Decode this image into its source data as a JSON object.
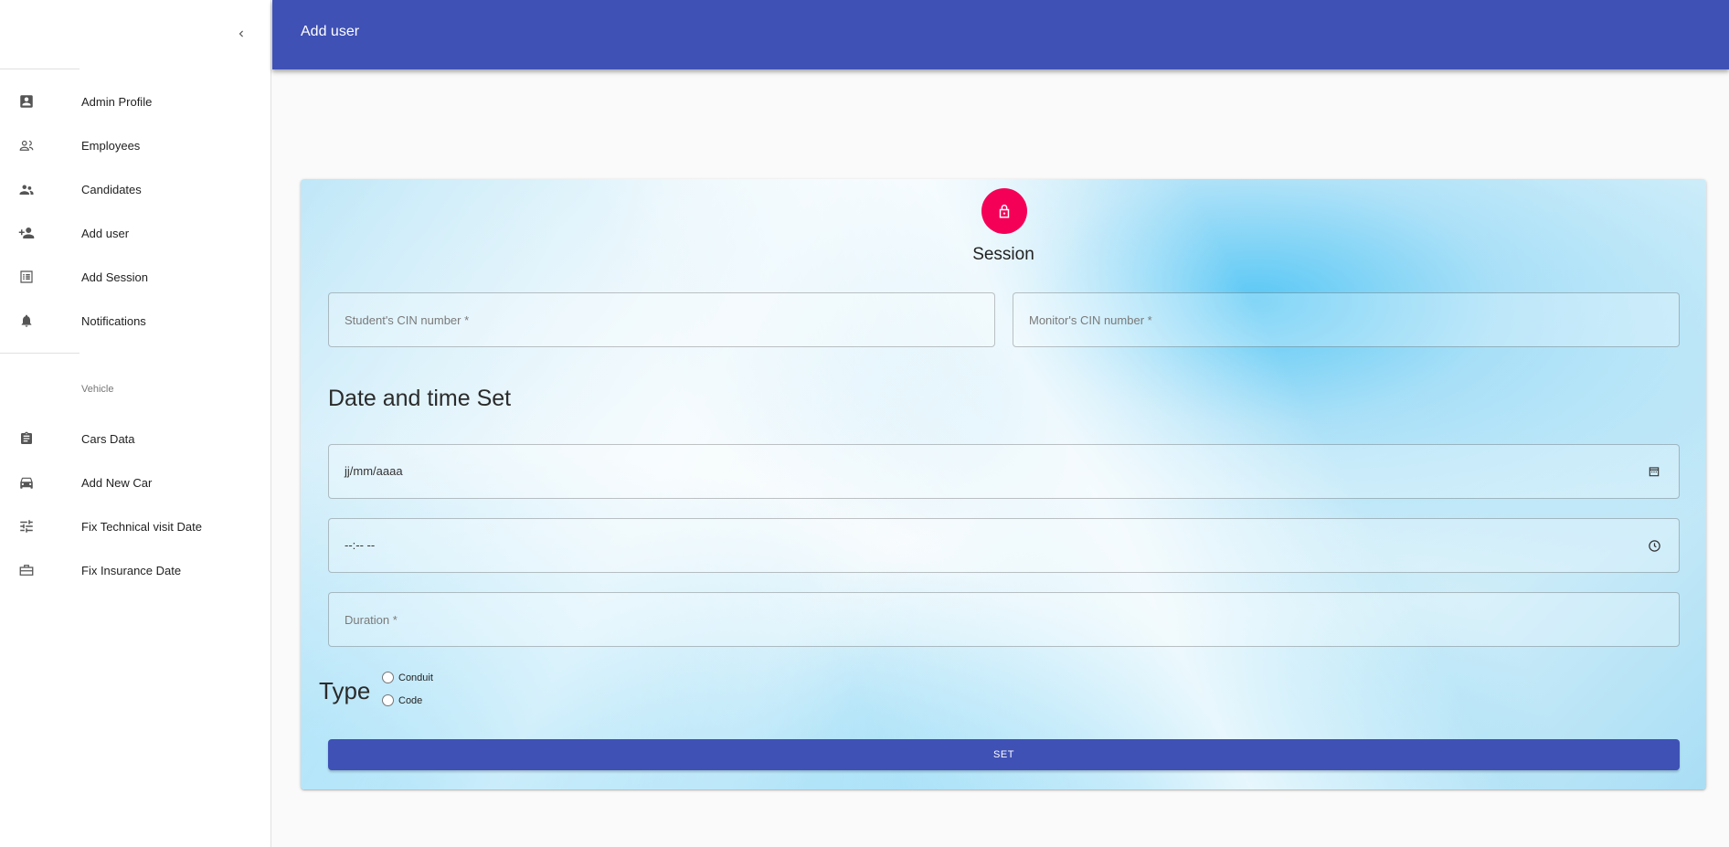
{
  "sidebar": {
    "collapse_icon": "chevron-left-icon",
    "items": [
      {
        "label": "Admin Profile",
        "icon": "account-box-icon"
      },
      {
        "label": "Employees",
        "icon": "people-outline-icon"
      },
      {
        "label": "Candidates",
        "icon": "supervisor-account-icon"
      },
      {
        "label": "Add user",
        "icon": "person-add-icon"
      },
      {
        "label": "Add Session",
        "icon": "list-alt-icon"
      },
      {
        "label": "Notifications",
        "icon": "notifications-icon"
      }
    ],
    "section_label": "Vehicle",
    "vehicle_items": [
      {
        "label": "Cars Data",
        "icon": "assignment-icon"
      },
      {
        "label": "Add New Car",
        "icon": "car-icon"
      },
      {
        "label": "Fix Technical visit Date",
        "icon": "tune-icon"
      },
      {
        "label": "Fix Insurance Date",
        "icon": "work-icon"
      }
    ]
  },
  "header": {
    "title": "Add user",
    "color": "#3f51b5"
  },
  "form": {
    "avatar_icon": "lock-outlined-icon",
    "avatar_color": "#f50057",
    "title": "Session",
    "student_cin_placeholder": "Student's CIN number *",
    "monitor_cin_placeholder": "Monitor's CIN number *",
    "datetime_heading": "Date and time Set",
    "date_value": "jj/mm/aaaa",
    "date_icon": "calendar-icon",
    "time_value": "--:-- --",
    "time_icon": "clock-icon",
    "duration_placeholder": "Duration *",
    "type_label": "Type",
    "type_options": [
      {
        "label": "Conduit",
        "checked": false
      },
      {
        "label": "Code",
        "checked": false
      }
    ],
    "submit_label": "SET"
  }
}
